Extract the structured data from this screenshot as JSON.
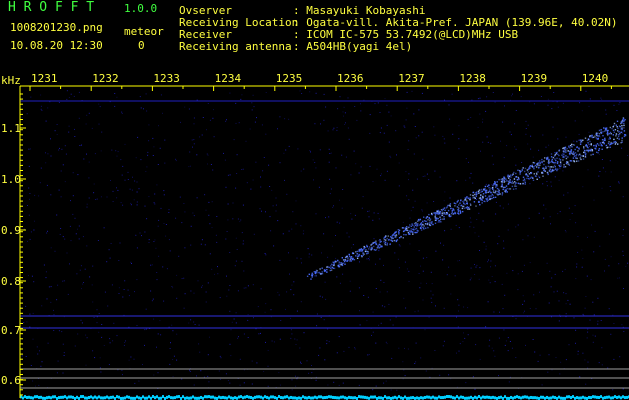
{
  "app": {
    "title": "H R O F F T",
    "version": "1.0.0"
  },
  "file": {
    "name": "1008201230.png",
    "datetime": "10.08.20 12:30"
  },
  "meteor": {
    "label": "meteor",
    "count": "0"
  },
  "station": [
    {
      "key": "Ovserver",
      "value": ": Masayuki Kobayashi"
    },
    {
      "key": "Receiving Location",
      "value": ": Ogata-vill. Akita-Pref. JAPAN (139.96E, 40.02N)"
    },
    {
      "key": "Receiver",
      "value": ": ICOM IC-575 53.7492(@LCD)MHz USB"
    },
    {
      "key": "Receiving antenna",
      "value": ": A504HB(yagi 4el)"
    }
  ],
  "plot": {
    "y_unit": "kHz",
    "x_ticks": [
      "1231",
      "1232",
      "1233",
      "1234",
      "1235",
      "1236",
      "1237",
      "1238",
      "1239",
      "1240"
    ],
    "y_ticks": [
      "1.1",
      "1.0",
      "0.9",
      "0.8",
      "0.7",
      "0.6"
    ],
    "colors": {
      "noise": "#2020c0",
      "echo": "#4a6cff",
      "axis": "#ffff00",
      "baseline": "#00d0ff"
    }
  }
}
